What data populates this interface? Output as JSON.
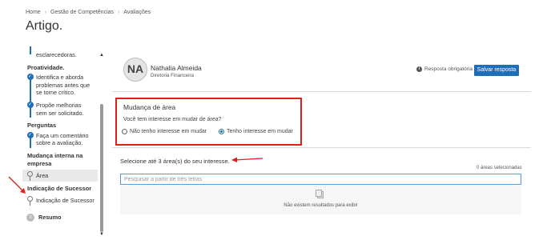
{
  "breadcrumb": [
    "Home",
    "Gestão de Competências",
    "Avaliações"
  ],
  "page_title": "Artigo.",
  "sidebar": {
    "top_fragment": "esclarecedoras.",
    "sections": [
      {
        "title": "Proatividade.",
        "items": [
          "Identifica e aborda problemas antes que se torne crítico.",
          "Propõe melhorias sem ser solicitado."
        ]
      },
      {
        "title": "Perguntas",
        "items": [
          "Faça um comentário sobre a avaliação."
        ]
      },
      {
        "title": "Mudança interna na empresa",
        "items": [
          "Área"
        ]
      },
      {
        "title": "Indicação de Sucessor",
        "items": [
          "Indicação de Sucessor"
        ]
      }
    ],
    "summary_label": "Resumo"
  },
  "user": {
    "initials": "NA",
    "name": "Nathalia Almeida",
    "role": "Diretoria Financeira"
  },
  "required_note": "Resposta obrigatória",
  "save_label": "Salvar resposta",
  "mudanca": {
    "title": "Mudança de área",
    "question": "Você tem interesse em mudar de área?",
    "options": [
      {
        "label": "Não tenho interesse em mudar",
        "checked": false
      },
      {
        "label": "Tenho interesse em mudar",
        "checked": true
      }
    ]
  },
  "area_select": {
    "label": "Selecione até 3 área(s) do seu interesse.",
    "count": "0 áreas selecionadas",
    "placeholder": "Pesquisar a partir de três letras",
    "empty_text": "Não existem resultados para exibir"
  },
  "colors": {
    "primary": "#1e6fb8",
    "highlight": "#e0201a"
  }
}
